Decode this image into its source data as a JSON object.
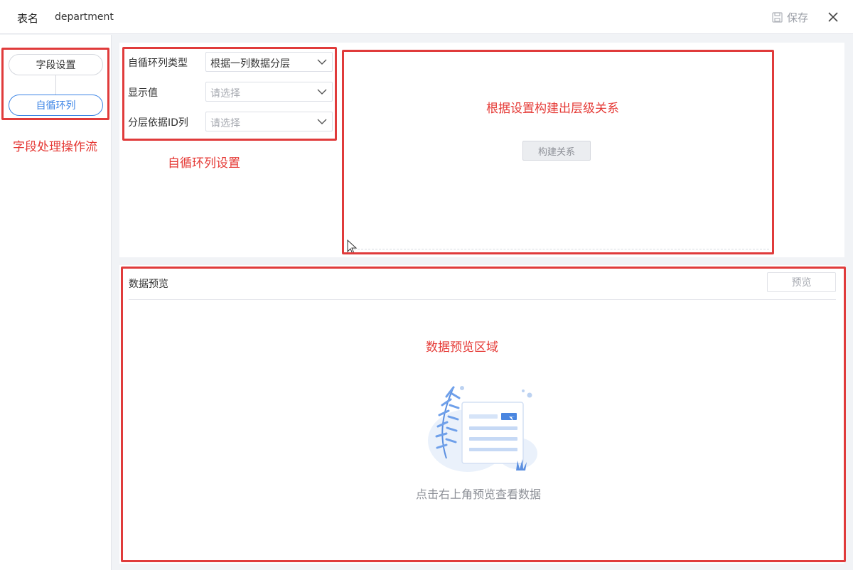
{
  "header": {
    "table_label": "表名",
    "table_name": "department",
    "save_label": "保存",
    "icons": {
      "save": "save-icon",
      "close": "close-icon"
    }
  },
  "flow": {
    "nodes": [
      "字段设置",
      "自循环列"
    ],
    "active_index": 1,
    "annotation": "字段处理操作流"
  },
  "settings": {
    "fields": [
      {
        "label": "自循环列类型",
        "value": "根据一列数据分层",
        "placeholder": false
      },
      {
        "label": "显示值",
        "value": "请选择",
        "placeholder": true
      },
      {
        "label": "分层依据ID列",
        "value": "请选择",
        "placeholder": true
      }
    ],
    "annotation": "自循环列设置"
  },
  "relation": {
    "annotation": "根据设置构建出层级关系",
    "build_button": "构建关系"
  },
  "preview": {
    "title": "数据预览",
    "preview_button": "预览",
    "annotation": "数据预览区域",
    "empty_text": "点击右上角预览查看数据"
  },
  "colors": {
    "accent": "#3d85e6",
    "annotation_red": "#e53935",
    "background": "#f1f3f6"
  }
}
